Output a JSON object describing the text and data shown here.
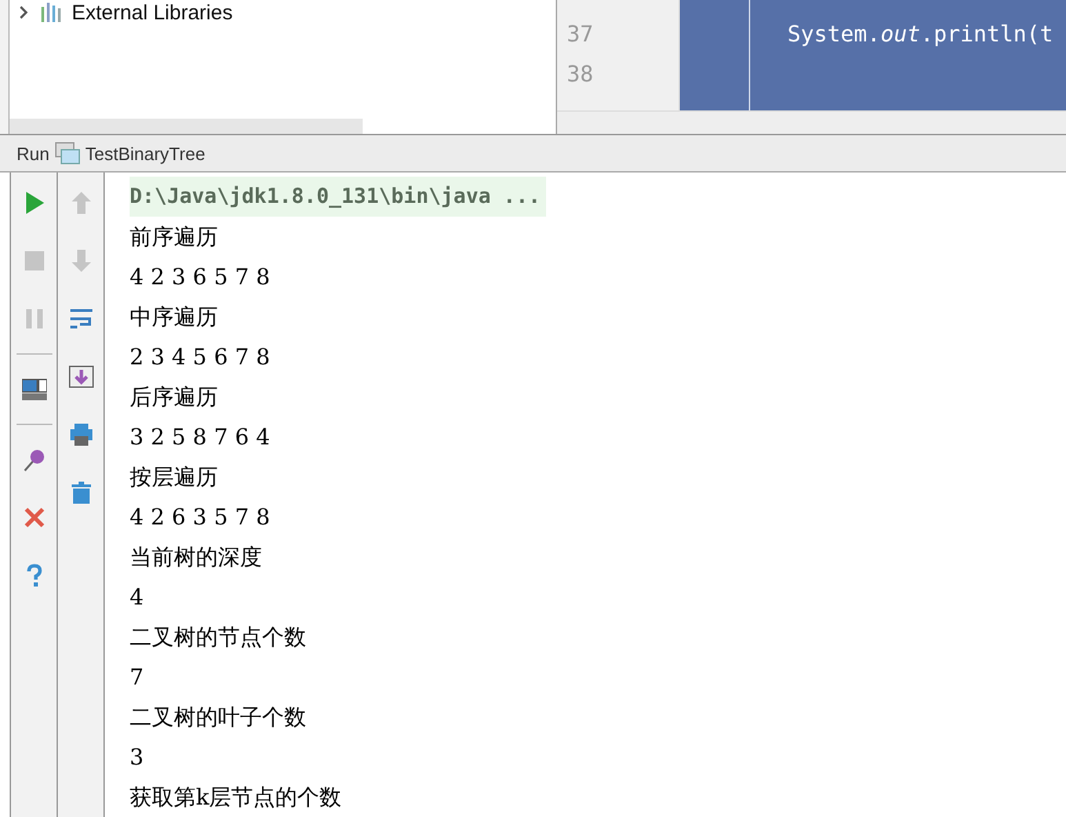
{
  "project_tree": {
    "items": [
      {
        "label": "External Libraries",
        "expanded": false
      }
    ]
  },
  "editor": {
    "lines": [
      {
        "number": "37",
        "code": "System.*out*.println(t"
      },
      {
        "number": "38"
      }
    ]
  },
  "run_panel": {
    "label": "Run",
    "config": "TestBinaryTree"
  },
  "toolbar_left": [
    {
      "kind": "run",
      "disabled": false
    },
    {
      "kind": "stop",
      "disabled": true
    },
    {
      "kind": "pause",
      "disabled": true
    },
    {
      "kind": "sep"
    },
    {
      "kind": "layout",
      "disabled": false
    },
    {
      "kind": "sep"
    },
    {
      "kind": "pin",
      "disabled": false
    },
    {
      "kind": "close",
      "disabled": false
    },
    {
      "kind": "help",
      "disabled": false
    }
  ],
  "toolbar_right": [
    {
      "kind": "up",
      "disabled": true
    },
    {
      "kind": "down",
      "disabled": true
    },
    {
      "kind": "wrap",
      "disabled": false
    },
    {
      "kind": "scroll",
      "disabled": false
    },
    {
      "kind": "print",
      "disabled": false
    },
    {
      "kind": "trash",
      "disabled": false
    }
  ],
  "console": [
    {
      "kind": "command",
      "text": "D:\\Java\\jdk1.8.0_131\\bin\\java ..."
    },
    {
      "kind": "output",
      "text": "前序遍历"
    },
    {
      "kind": "output",
      "text": "4 2 3 6 5 7 8"
    },
    {
      "kind": "output",
      "text": "中序遍历"
    },
    {
      "kind": "output",
      "text": "2 3 4 5 6 7 8"
    },
    {
      "kind": "output",
      "text": "后序遍历"
    },
    {
      "kind": "output",
      "text": "3 2 5 8 7 6 4"
    },
    {
      "kind": "output",
      "text": "按层遍历"
    },
    {
      "kind": "output",
      "text": "4 2 6 3 5 7 8"
    },
    {
      "kind": "output",
      "text": "当前树的深度"
    },
    {
      "kind": "output",
      "text": "4"
    },
    {
      "kind": "output",
      "text": "二叉树的节点个数"
    },
    {
      "kind": "output",
      "text": "7"
    },
    {
      "kind": "output",
      "text": "二叉树的叶子个数"
    },
    {
      "kind": "output",
      "text": "3"
    },
    {
      "kind": "output",
      "text": "获取第k层节点的个数"
    }
  ]
}
